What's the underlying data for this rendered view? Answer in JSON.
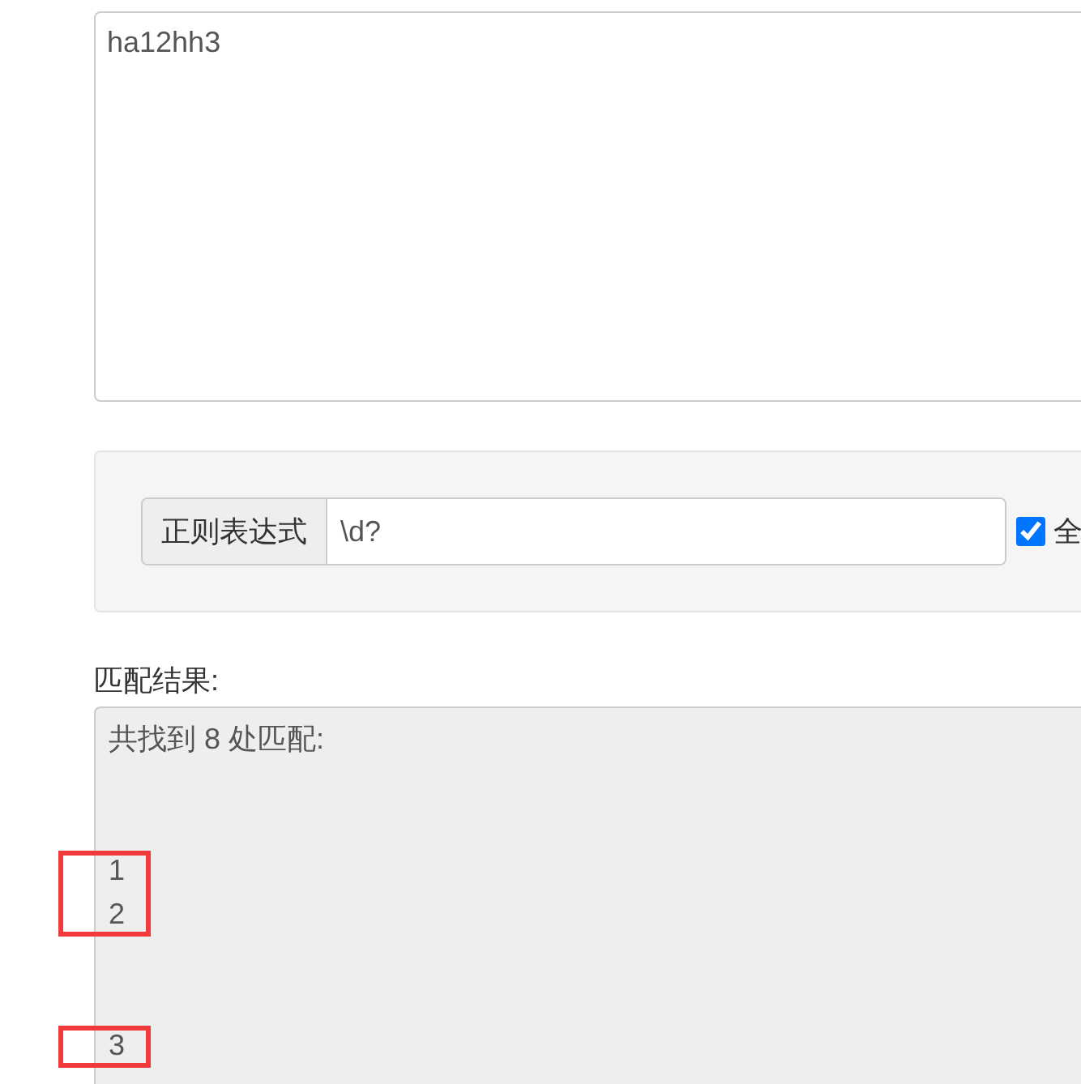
{
  "source_text": {
    "value": "ha12hh3"
  },
  "regex_panel": {
    "addon": "正则表达式",
    "pattern": "\\d?",
    "global_option": {
      "label": "全",
      "checked": true
    }
  },
  "results": {
    "label": "匹配结果:",
    "summary": "共找到 8 处匹配:",
    "lines": [
      {
        "kind": "empty"
      },
      {
        "kind": "empty"
      },
      {
        "kind": "value",
        "text": "1",
        "highlighted": true
      },
      {
        "kind": "value",
        "text": "2",
        "highlighted": true
      },
      {
        "kind": "empty"
      },
      {
        "kind": "empty"
      },
      {
        "kind": "value",
        "text": "3",
        "highlighted": true
      },
      {
        "kind": "empty"
      }
    ]
  }
}
